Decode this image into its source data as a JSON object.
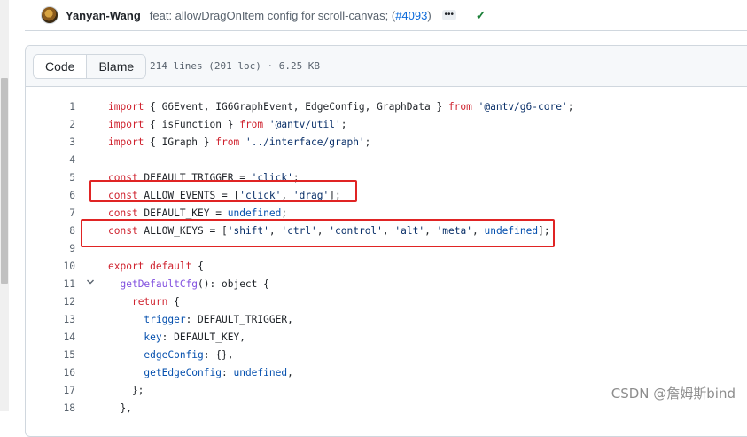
{
  "commit": {
    "author": "Yanyan-Wang",
    "message": "feat: allowDragOnItem config for scroll-canvas; (",
    "pr_link": "#4093",
    "message_close": ")",
    "ellipsis": "•••",
    "status_icon": "check-icon"
  },
  "file": {
    "tabs": [
      {
        "label": "Code",
        "active": true
      },
      {
        "label": "Blame",
        "active": false
      }
    ],
    "meta": "214 lines (201 loc) · 6.25 KB"
  },
  "code_lines": [
    {
      "num": "1",
      "fold": "",
      "tokens": [
        {
          "t": "import",
          "c": "k"
        },
        {
          "t": " { G6Event, IG6GraphEvent, EdgeConfig, GraphData } ",
          "c": "p"
        },
        {
          "t": "from",
          "c": "k"
        },
        {
          "t": " ",
          "c": "p"
        },
        {
          "t": "'@antv/g6-core'",
          "c": "s"
        },
        {
          "t": ";",
          "c": "p"
        }
      ]
    },
    {
      "num": "2",
      "fold": "",
      "tokens": [
        {
          "t": "import",
          "c": "k"
        },
        {
          "t": " { isFunction } ",
          "c": "p"
        },
        {
          "t": "from",
          "c": "k"
        },
        {
          "t": " ",
          "c": "p"
        },
        {
          "t": "'@antv/util'",
          "c": "s"
        },
        {
          "t": ";",
          "c": "p"
        }
      ]
    },
    {
      "num": "3",
      "fold": "",
      "tokens": [
        {
          "t": "import",
          "c": "k"
        },
        {
          "t": " { IGraph } ",
          "c": "p"
        },
        {
          "t": "from",
          "c": "k"
        },
        {
          "t": " ",
          "c": "p"
        },
        {
          "t": "'../interface/graph'",
          "c": "s"
        },
        {
          "t": ";",
          "c": "p"
        }
      ]
    },
    {
      "num": "4",
      "fold": "",
      "tokens": []
    },
    {
      "num": "5",
      "fold": "",
      "tokens": [
        {
          "t": "const",
          "c": "k"
        },
        {
          "t": " DEFAULT_TRIGGER = ",
          "c": "p"
        },
        {
          "t": "'click'",
          "c": "s"
        },
        {
          "t": ";",
          "c": "p"
        }
      ]
    },
    {
      "num": "6",
      "fold": "",
      "tokens": [
        {
          "t": "const",
          "c": "k"
        },
        {
          "t": " ALLOW_EVENTS = [",
          "c": "p"
        },
        {
          "t": "'click'",
          "c": "s"
        },
        {
          "t": ", ",
          "c": "p"
        },
        {
          "t": "'drag'",
          "c": "s"
        },
        {
          "t": "];",
          "c": "p"
        }
      ]
    },
    {
      "num": "7",
      "fold": "",
      "tokens": [
        {
          "t": "const",
          "c": "k"
        },
        {
          "t": " DEFAULT_KEY = ",
          "c": "p"
        },
        {
          "t": "undefined",
          "c": "c"
        },
        {
          "t": ";",
          "c": "p"
        }
      ]
    },
    {
      "num": "8",
      "fold": "",
      "tokens": [
        {
          "t": "const",
          "c": "k"
        },
        {
          "t": " ALLOW_KEYS = [",
          "c": "p"
        },
        {
          "t": "'shift'",
          "c": "s"
        },
        {
          "t": ", ",
          "c": "p"
        },
        {
          "t": "'ctrl'",
          "c": "s"
        },
        {
          "t": ", ",
          "c": "p"
        },
        {
          "t": "'control'",
          "c": "s"
        },
        {
          "t": ", ",
          "c": "p"
        },
        {
          "t": "'alt'",
          "c": "s"
        },
        {
          "t": ", ",
          "c": "p"
        },
        {
          "t": "'meta'",
          "c": "s"
        },
        {
          "t": ", ",
          "c": "p"
        },
        {
          "t": "undefined",
          "c": "c"
        },
        {
          "t": "];",
          "c": "p"
        }
      ]
    },
    {
      "num": "9",
      "fold": "",
      "tokens": []
    },
    {
      "num": "10",
      "fold": "",
      "tokens": [
        {
          "t": "export",
          "c": "k"
        },
        {
          "t": " ",
          "c": "p"
        },
        {
          "t": "default",
          "c": "k"
        },
        {
          "t": " {",
          "c": "p"
        }
      ]
    },
    {
      "num": "11",
      "fold": "chevron-down-icon",
      "tokens": [
        {
          "t": "  ",
          "c": "p"
        },
        {
          "t": "getDefaultCfg",
          "c": "f"
        },
        {
          "t": "(): object {",
          "c": "p"
        }
      ]
    },
    {
      "num": "12",
      "fold": "",
      "tokens": [
        {
          "t": "    ",
          "c": "p"
        },
        {
          "t": "return",
          "c": "k"
        },
        {
          "t": " {",
          "c": "p"
        }
      ]
    },
    {
      "num": "13",
      "fold": "",
      "tokens": [
        {
          "t": "      ",
          "c": "p"
        },
        {
          "t": "trigger",
          "c": "c"
        },
        {
          "t": ": DEFAULT_TRIGGER,",
          "c": "p"
        }
      ]
    },
    {
      "num": "14",
      "fold": "",
      "tokens": [
        {
          "t": "      ",
          "c": "p"
        },
        {
          "t": "key",
          "c": "c"
        },
        {
          "t": ": DEFAULT_KEY,",
          "c": "p"
        }
      ]
    },
    {
      "num": "15",
      "fold": "",
      "tokens": [
        {
          "t": "      ",
          "c": "p"
        },
        {
          "t": "edgeConfig",
          "c": "c"
        },
        {
          "t": ": {},",
          "c": "p"
        }
      ]
    },
    {
      "num": "16",
      "fold": "",
      "tokens": [
        {
          "t": "      ",
          "c": "p"
        },
        {
          "t": "getEdgeConfig",
          "c": "c"
        },
        {
          "t": ": ",
          "c": "p"
        },
        {
          "t": "undefined",
          "c": "c"
        },
        {
          "t": ",",
          "c": "p"
        }
      ]
    },
    {
      "num": "17",
      "fold": "",
      "tokens": [
        {
          "t": "    };",
          "c": "p"
        }
      ]
    },
    {
      "num": "18",
      "fold": "",
      "tokens": [
        {
          "t": "  },",
          "c": "p"
        }
      ]
    }
  ],
  "highlight_color": "#e02424",
  "watermark": "CSDN @詹姆斯bind"
}
